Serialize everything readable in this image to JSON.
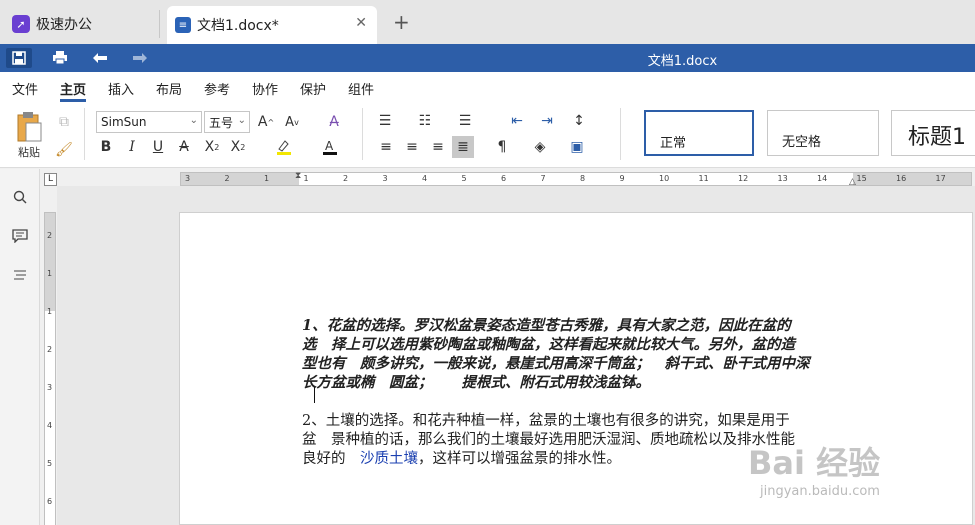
{
  "tabs": {
    "app_label": "极速办公",
    "doc_label": "文档1.docx*",
    "close_glyph": "✕",
    "add_glyph": "+"
  },
  "titlebar": {
    "title": "文档1.docx"
  },
  "menu": {
    "items": [
      "文件",
      "主页",
      "插入",
      "布局",
      "参考",
      "协作",
      "保护",
      "组件"
    ],
    "active": "主页"
  },
  "ribbon": {
    "paste_label": "粘贴",
    "font_name": "SimSun",
    "font_size": "五号",
    "styles": [
      "正常",
      "无空格",
      "标题1"
    ]
  },
  "ruler": {
    "h_numbers": [
      "3",
      "2",
      "1",
      "1",
      "2",
      "3",
      "4",
      "5",
      "6",
      "7",
      "8",
      "9",
      "10",
      "11",
      "12",
      "13",
      "14",
      "15",
      "16",
      "17"
    ],
    "v_numbers": [
      "2",
      "1",
      "1",
      "2",
      "3",
      "4",
      "5",
      "6",
      "7"
    ],
    "corner": "L"
  },
  "document": {
    "p1_lines": [
      "1、花盆的选择。罗汉松盆景姿态造型苍古秀雅，具有大家之范，因此在盆的",
      "选　择上可以选用紫砂陶盆或釉陶盆，这样看起来就比较大气。另外，盆的造",
      "型也有　颇多讲究，一般来说，悬崖式用高深千筒盆；　斜干式、卧干式用中深",
      "长方盆或椭　圆盆；　　提根式、附石式用较浅盆钵。"
    ],
    "p2_lines": [
      "2、土壤的选择。和花卉种植一样，盆景的土壤也有很多的讲究，如果是用于",
      "盆　景种植的话，那么我们的土壤最好选用肥沃湿润、质地疏松以及排水性能"
    ],
    "p2_line3_prefix": "良好的　",
    "p2_link": "沙质土壤",
    "p2_line3_suffix": "，这样可以增强盆景的排水性。"
  },
  "watermark": {
    "main": "Bai 经验",
    "sub": "jingyan.baidu.com"
  }
}
